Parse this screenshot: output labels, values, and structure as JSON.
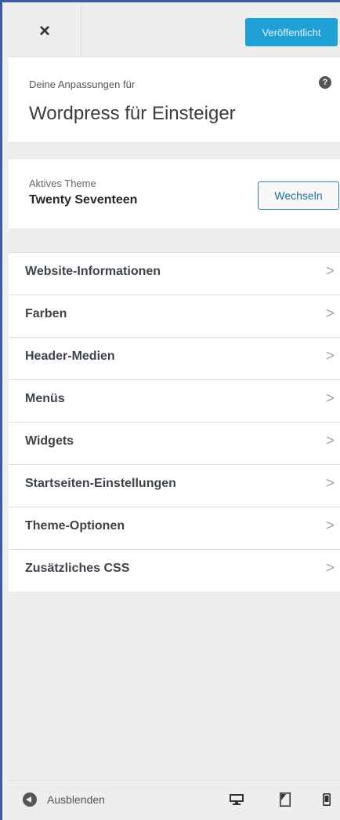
{
  "header": {
    "close_label": "×",
    "publish_label": "Veröffentlicht"
  },
  "info": {
    "subtitle": "Deine Anpassungen für",
    "site_title": "Wordpress für Einsteiger",
    "help_icon": "?"
  },
  "theme": {
    "label": "Aktives Theme",
    "name": "Twenty Seventeen",
    "switch_label": "Wechseln"
  },
  "menu": {
    "items": [
      {
        "label": "Website-Informationen",
        "icon": "chevron-right-icon"
      },
      {
        "label": "Farben",
        "icon": "chevron-right-icon"
      },
      {
        "label": "Header-Medien",
        "icon": "chevron-right-icon"
      },
      {
        "label": "Menüs",
        "icon": "chevron-right-icon"
      },
      {
        "label": "Widgets",
        "icon": "chevron-right-icon"
      },
      {
        "label": "Startseiten-Einstellungen",
        "icon": "chevron-right-icon"
      },
      {
        "label": "Theme-Optionen",
        "icon": "chevron-right-icon"
      },
      {
        "label": "Zusätzliches CSS",
        "icon": "chevron-right-icon"
      }
    ],
    "chevron": ">"
  },
  "footer": {
    "collapse_label": "Ausblenden",
    "devices": [
      "desktop-icon",
      "tablet-icon",
      "mobile-icon"
    ]
  },
  "colors": {
    "accent": "#1fa0d6",
    "frame_border": "#3b5ba7",
    "panel_bg": "#eeeeee"
  }
}
